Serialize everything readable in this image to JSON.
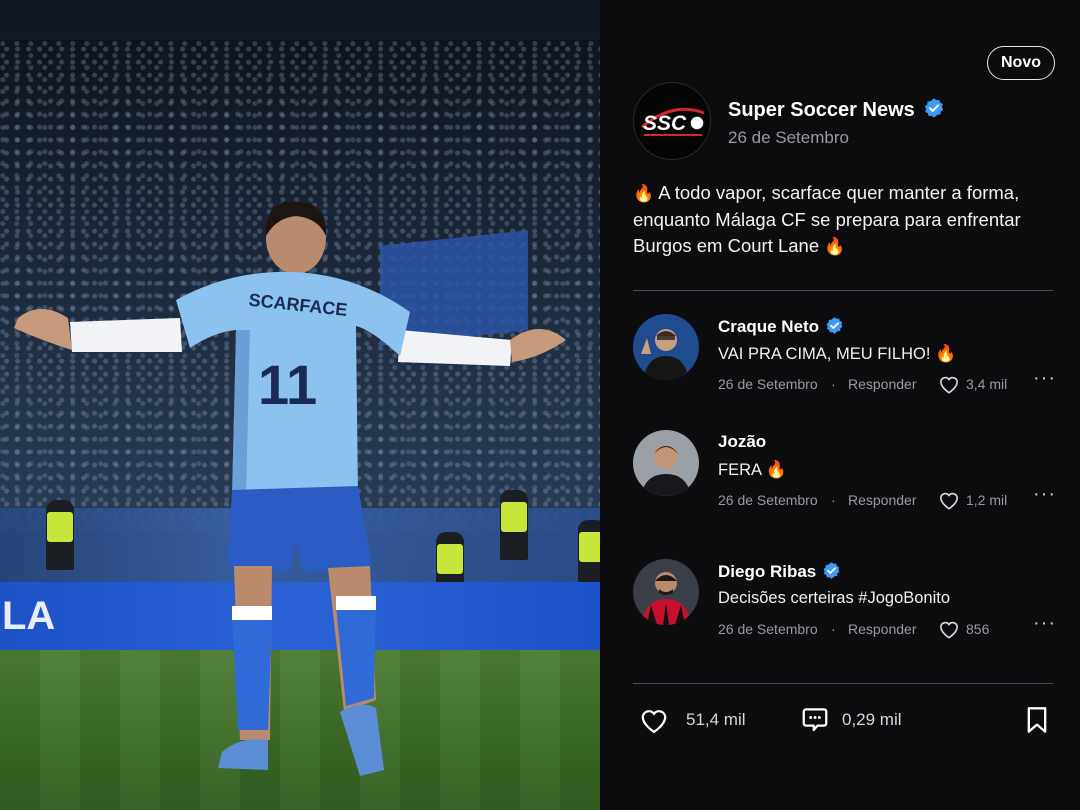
{
  "badge": {
    "label": "Novo"
  },
  "post": {
    "author": "Super Soccer News",
    "avatar_text": "SSC",
    "date": "26 de Setembro",
    "text_line1": "A todo vapor, scarface quer manter a forma,",
    "text_line2": "enquanto Málaga CF se prepara para enfrentar",
    "text_line3": "Burgos em Court Lane",
    "likes": "51,4 mil",
    "comments": "0,29 mil"
  },
  "photo": {
    "jersey_name": "SCARFACE",
    "jersey_number": "11",
    "adboard_left": "LA"
  },
  "comments": [
    {
      "name": "Craque Neto",
      "verified": true,
      "text": "VAI PRA CIMA, MEU FILHO!",
      "date": "26 de Setembro",
      "dot": "·",
      "reply": "Responder",
      "likes": "3,4 mil",
      "more": "···"
    },
    {
      "name": "Jozão",
      "verified": false,
      "text": "FERA",
      "date": "26 de Setembro",
      "dot": "·",
      "reply": "Responder",
      "likes": "1,2 mil",
      "more": "···"
    },
    {
      "name": "Diego Ribas",
      "verified": true,
      "text": "Decisões certeiras #JogoBonito",
      "date": "26 de Setembro",
      "dot": "·",
      "reply": "Responder",
      "likes": "856",
      "more": "···"
    }
  ],
  "colors": {
    "verified": "#3d9bf0",
    "panel_bg": "#0c0c0f",
    "fire": "#ff5a1f",
    "jersey": "#8cc2ef"
  },
  "icons": {
    "fire": "fire-emoji-icon",
    "like": "heart-icon",
    "comment": "comment-bubble-icon",
    "save": "bookmark-icon",
    "more": "more-dots-icon",
    "verified": "verified-check-icon"
  }
}
